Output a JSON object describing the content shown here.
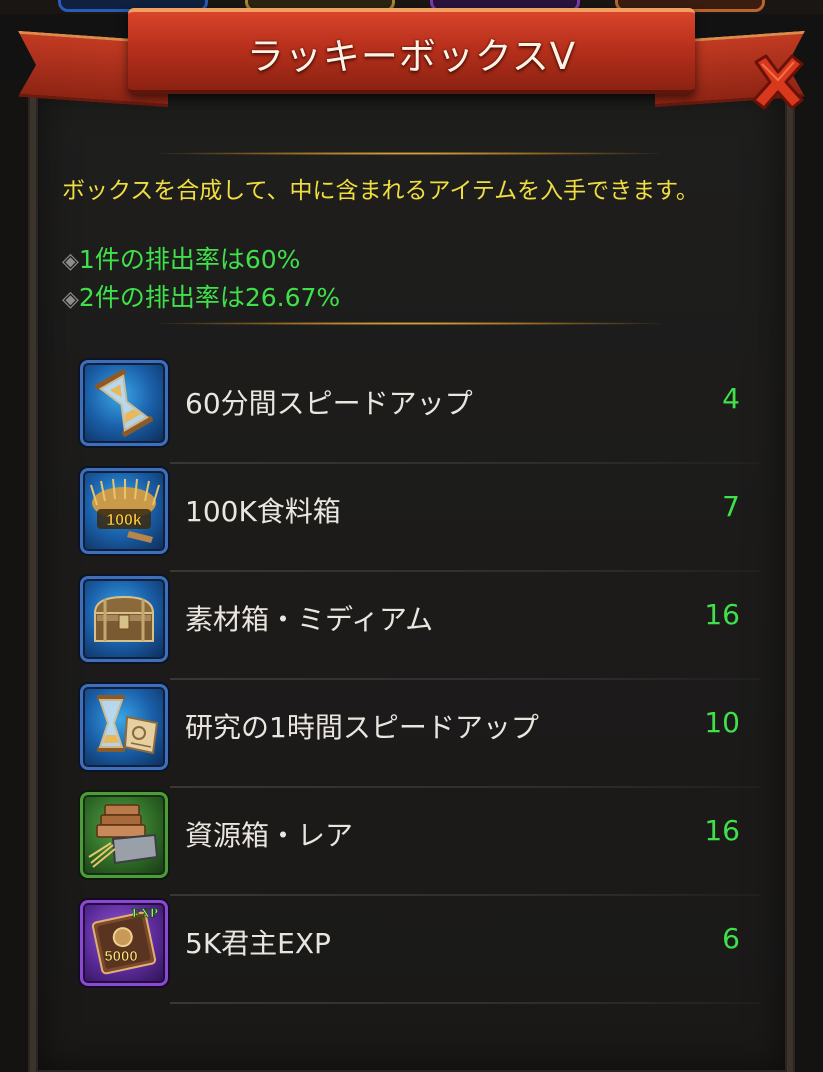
{
  "header": {
    "title": "ラッキーボックスV",
    "close_icon": "close-x-icon"
  },
  "description": {
    "text": "ボックスを合成して、中に含まれるアイテムを入手できます。",
    "rates": [
      {
        "prefix": "1件の排出率は",
        "value": "60%"
      },
      {
        "prefix": "2件の排出率は",
        "value": "26.67%"
      }
    ]
  },
  "items": [
    {
      "name": "60分間スピードアップ",
      "count": "4",
      "icon": "hourglass-icon",
      "frame": "blue"
    },
    {
      "name": "100K食料箱",
      "count": "7",
      "icon": "wheat-food-icon",
      "badge": "100k",
      "frame": "blue"
    },
    {
      "name": "素材箱・ミディアム",
      "count": "16",
      "icon": "treasure-chest-icon",
      "frame": "blue"
    },
    {
      "name": "研究の1時間スピードアップ",
      "count": "10",
      "icon": "research-hourglass-icon",
      "frame": "blue"
    },
    {
      "name": "資源箱・レア",
      "count": "16",
      "icon": "resource-crate-icon",
      "frame": "green"
    },
    {
      "name": "5K君主EXP",
      "count": "6",
      "icon": "exp-book-icon",
      "badge": "5000",
      "badge_top": "EXP",
      "frame": "purple"
    }
  ],
  "colors": {
    "accent_green": "#3fe04a",
    "description_yellow": "#f0de40",
    "ribbon_red": "#c23a22"
  }
}
